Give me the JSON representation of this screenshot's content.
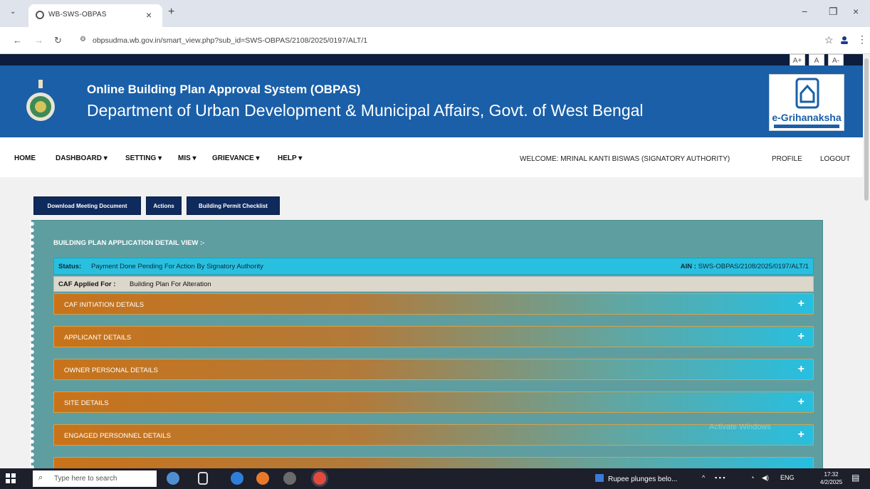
{
  "browser": {
    "tab_title": "WB-SWS-OBPAS",
    "url": "obpsudma.wb.gov.in/smart_view.php?sub_id=SWS-OBPAS/2108/2025/0197/ALT/1"
  },
  "font_controls": [
    "A+",
    "A",
    "A-"
  ],
  "header": {
    "line1": "Online Building Plan Approval System (OBPAS)",
    "line2": "Department of Urban Development & Municipal Affairs, Govt. of West Bengal",
    "logo_text": "e-Grihanaksha"
  },
  "menu": {
    "items": [
      "HOME",
      "DASHBOARD ▾",
      "SETTING ▾",
      "MIS ▾",
      "GRIEVANCE ▾",
      "HELP ▾"
    ],
    "welcome": "WELCOME: MRINAL KANTI BISWAS (SIGNATORY AUTHORITY)",
    "profile": "PROFILE",
    "logout": "LOGOUT"
  },
  "buttons": {
    "download": "Download Meeting Document",
    "actions": "Actions",
    "checklist": "Building Permit Checklist"
  },
  "panel": {
    "title": "BUILDING PLAN APPLICATION DETAIL VIEW :-",
    "status_label": "Status:",
    "status_value": "Payment Done Pending For Action By Signatory Authority",
    "ain_label": "AIN :",
    "ain_value": "SWS-OBPAS/2108/2025/0197/ALT/1",
    "caf_label": "CAF Applied For :",
    "caf_value": "Building Plan For Alteration",
    "sections": [
      "CAF INITIATION DETAILS",
      "APPLICANT DETAILS",
      "OWNER PERSONAL DETAILS",
      "SITE DETAILS",
      "ENGAGED PERSONNEL DETAILS"
    ],
    "plus_symbol": "+"
  },
  "watermark": "Activate Windows",
  "taskbar": {
    "search_placeholder": "Type here to search",
    "news": "Rupee plunges belo...",
    "lang": "ENG",
    "time": "17:32",
    "date": "4/2/2025"
  }
}
